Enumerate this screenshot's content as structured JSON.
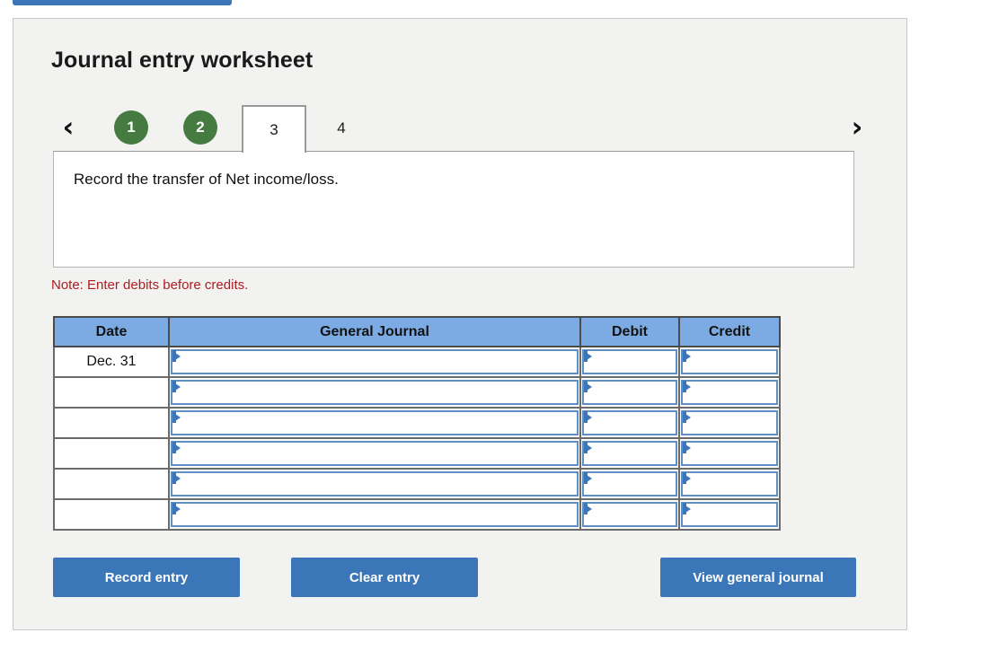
{
  "top_strip": {
    "label": ""
  },
  "panel": {
    "title": "Journal entry worksheet",
    "nav": {
      "prev_icon": "chevron-left-icon",
      "prev_glyph": "‹",
      "next_icon": "chevron-right-icon",
      "next_glyph": "›"
    },
    "tabs": [
      {
        "label": "1",
        "state": "completed"
      },
      {
        "label": "2",
        "state": "completed"
      },
      {
        "label": "3",
        "state": "active"
      },
      {
        "label": "4",
        "state": "inactive"
      }
    ],
    "description": "Record the transfer of Net income/loss.",
    "note": "Note: Enter debits before credits."
  },
  "table": {
    "columns": [
      "Date",
      "General Journal",
      "Debit",
      "Credit"
    ],
    "rows": [
      {
        "date": "Dec. 31",
        "general_journal": "",
        "debit": "",
        "credit": ""
      },
      {
        "date": "",
        "general_journal": "",
        "debit": "",
        "credit": ""
      },
      {
        "date": "",
        "general_journal": "",
        "debit": "",
        "credit": ""
      },
      {
        "date": "",
        "general_journal": "",
        "debit": "",
        "credit": ""
      },
      {
        "date": "",
        "general_journal": "",
        "debit": "",
        "credit": ""
      },
      {
        "date": "",
        "general_journal": "",
        "debit": "",
        "credit": ""
      }
    ]
  },
  "buttons": {
    "record": "Record entry",
    "clear": "Clear entry",
    "view": "View general journal"
  },
  "colors": {
    "header_blue": "#7cabe3",
    "button_blue": "#3b76b8",
    "completed_green": "#457b41",
    "note_red": "#b01c21",
    "panel_bg": "#f2f2f1"
  }
}
